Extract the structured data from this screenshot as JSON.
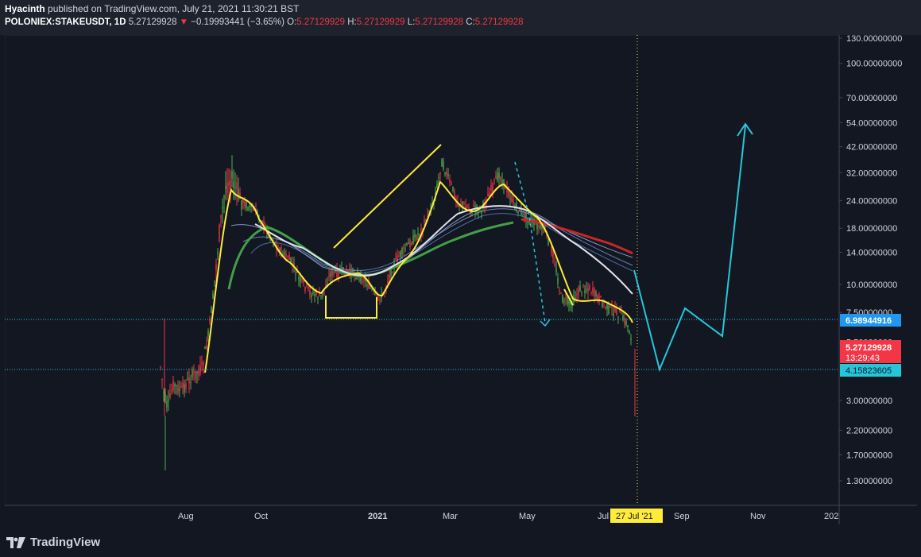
{
  "header": {
    "author": "Hyacinth",
    "published_text": "published on TradingView.com, July 21, 2021 11:30:21 BST",
    "symbol": "POLONIEX:STAKEUSDT, 1D",
    "last": "5.27129928",
    "change_arrow": "▼",
    "change": "−0.19993441 (−3.65%)",
    "open_label": "O:",
    "open": "5.27129929",
    "high_label": "H:",
    "high": "5.27129929",
    "low_label": "L:",
    "low": "5.27129928",
    "close_label": "C:",
    "close": "5.27129928"
  },
  "price_axis": {
    "ticks": [
      "130.00000000",
      "100.00000000",
      "70.00000000",
      "54.00000000",
      "42.00000000",
      "32.00000000",
      "24.00000000",
      "18.00000000",
      "14.00000000",
      "10.00000000",
      "7.50000000",
      "5.50000000",
      "3.00000000",
      "2.20000000",
      "1.70000000",
      "1.30000000"
    ],
    "tick_values": [
      130,
      100,
      70,
      54,
      42,
      32,
      24,
      18,
      14,
      10,
      7.5,
      5.5,
      3.0,
      2.2,
      1.7,
      1.3
    ],
    "label_level": "6.98944916",
    "label_current": "5.27129928",
    "label_countdown": "13:29:43",
    "label_support": "4.15823605"
  },
  "time_axis": {
    "labels": [
      "Aug",
      "Oct",
      "2021",
      "Mar",
      "May",
      "Jul",
      "Sep",
      "Nov",
      "202"
    ],
    "crosshair_label": "27 Jul '21"
  },
  "colors": {
    "background": "#131722",
    "up": "#4caf50",
    "down": "#f23645",
    "drawing_yellow": "#ffeb3b",
    "projection_cyan": "#26c6da",
    "level_blue": "#2196f3",
    "ma_white": "#e0e3eb",
    "ma_green": "#43a047",
    "ma_red": "#c62828",
    "ma_blue": "#5c7fbf"
  },
  "footer": {
    "brand": "TradingView"
  }
}
